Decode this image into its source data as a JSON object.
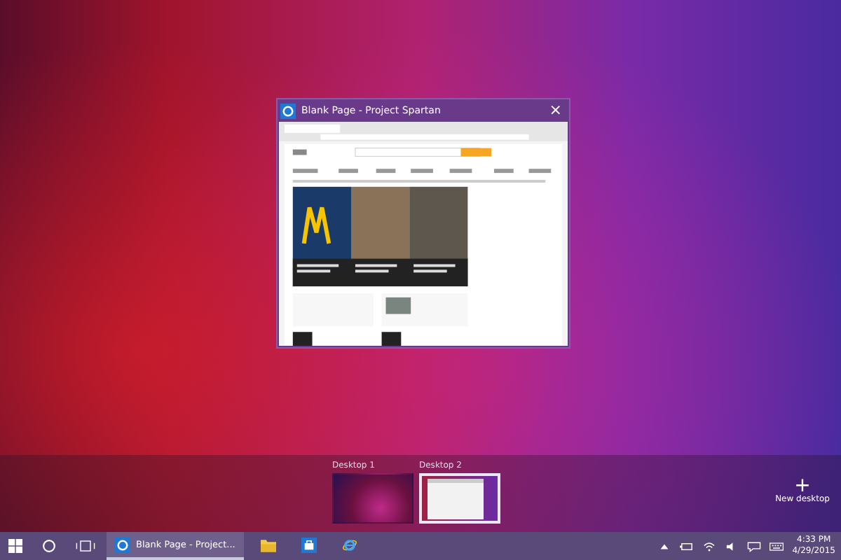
{
  "window": {
    "title": "Blank Page - Project Spartan",
    "close": "×"
  },
  "desktops": [
    {
      "label": "Desktop 1",
      "selected": false
    },
    {
      "label": "Desktop 2",
      "selected": true
    }
  ],
  "new_desktop": {
    "icon": "+",
    "label": "New desktop"
  },
  "taskbar": {
    "apps": [
      {
        "kind": "browser",
        "label": "Blank Page - Project...",
        "selected": true
      },
      {
        "kind": "folder",
        "selected": false
      },
      {
        "kind": "store",
        "selected": false
      },
      {
        "kind": "ie",
        "selected": false
      }
    ],
    "time": "4:33 PM",
    "date": "4/29/2015"
  }
}
